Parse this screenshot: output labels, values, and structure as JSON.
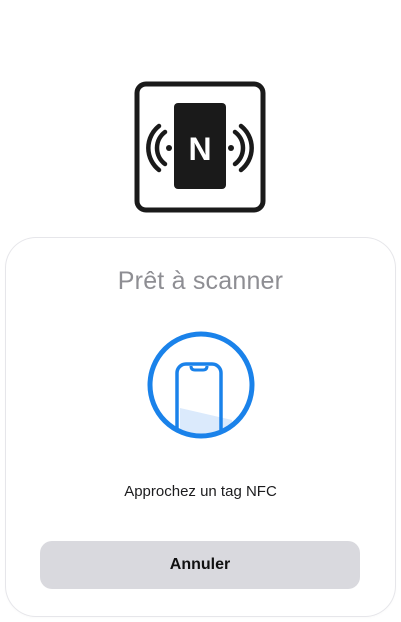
{
  "nfc_logo": {
    "letter": "N",
    "icon": "nfc-icon"
  },
  "sheet": {
    "title": "Prêt à scanner",
    "illustration_icon": "phone-scan-icon",
    "accent_color": "#1a82ea",
    "instruction": "Approchez un tag NFC",
    "cancel_label": "Annuler"
  }
}
